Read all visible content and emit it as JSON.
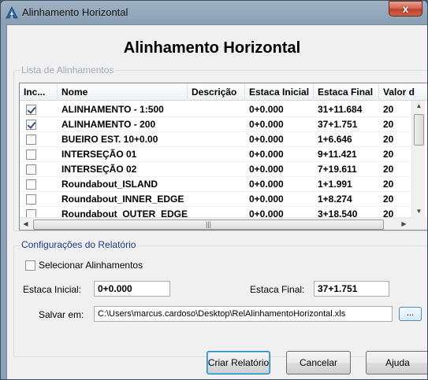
{
  "window": {
    "title": "Alinhamento Horizontal",
    "close_glyph": "x"
  },
  "heading": "Alinhamento Horizontal",
  "list_group": {
    "label": "Lista de Alinhamentos"
  },
  "grid": {
    "columns": [
      "Inc...",
      "Nome",
      "Descrição",
      "Estaca Inicial",
      "Estaca Final",
      "Valor d"
    ],
    "rows": [
      {
        "included": true,
        "name": "ALINHAMENTO - 1:500",
        "description": "",
        "start": "0+0.000",
        "end": "31+11.684",
        "value": "20"
      },
      {
        "included": true,
        "name": "ALINHAMENTO - 200",
        "description": "",
        "start": "0+0.000",
        "end": "37+1.751",
        "value": "20"
      },
      {
        "included": false,
        "name": "BUEIRO EST. 10+0.00",
        "description": "",
        "start": "0+0.000",
        "end": "1+6.646",
        "value": "20"
      },
      {
        "included": false,
        "name": "INTERSEÇÃO 01",
        "description": "",
        "start": "0+0.000",
        "end": "9+11.421",
        "value": "20"
      },
      {
        "included": false,
        "name": "INTERSEÇÃO 02",
        "description": "",
        "start": "0+0.000",
        "end": "7+19.611",
        "value": "20"
      },
      {
        "included": false,
        "name": "Roundabout_ISLAND",
        "description": "",
        "start": "0+0.000",
        "end": "1+1.991",
        "value": "20"
      },
      {
        "included": false,
        "name": "Roundabout_INNER_EDGE",
        "description": "",
        "start": "0+0.000",
        "end": "1+8.274",
        "value": "20"
      },
      {
        "included": false,
        "name": "Roundabout_OUTER_EDGE",
        "description": "",
        "start": "0+0.000",
        "end": "3+18.540",
        "value": "20"
      }
    ]
  },
  "report_group": {
    "label": "Configurações do Relatório",
    "select_label": "Selecionar Alinhamentos",
    "start_label": "Estaca Inicial:",
    "start_value": "0+0.000",
    "end_label": "Estaca Final:",
    "end_value": "37+1.751",
    "save_label": "Salvar em:",
    "save_path": "C:\\Users\\marcus.cardoso\\Desktop\\RelAlinhamentoHorizontal.xls",
    "browse_label": "..."
  },
  "buttons": {
    "create": "Criar Relatório",
    "cancel": "Cancelar",
    "help": "Ajuda"
  }
}
